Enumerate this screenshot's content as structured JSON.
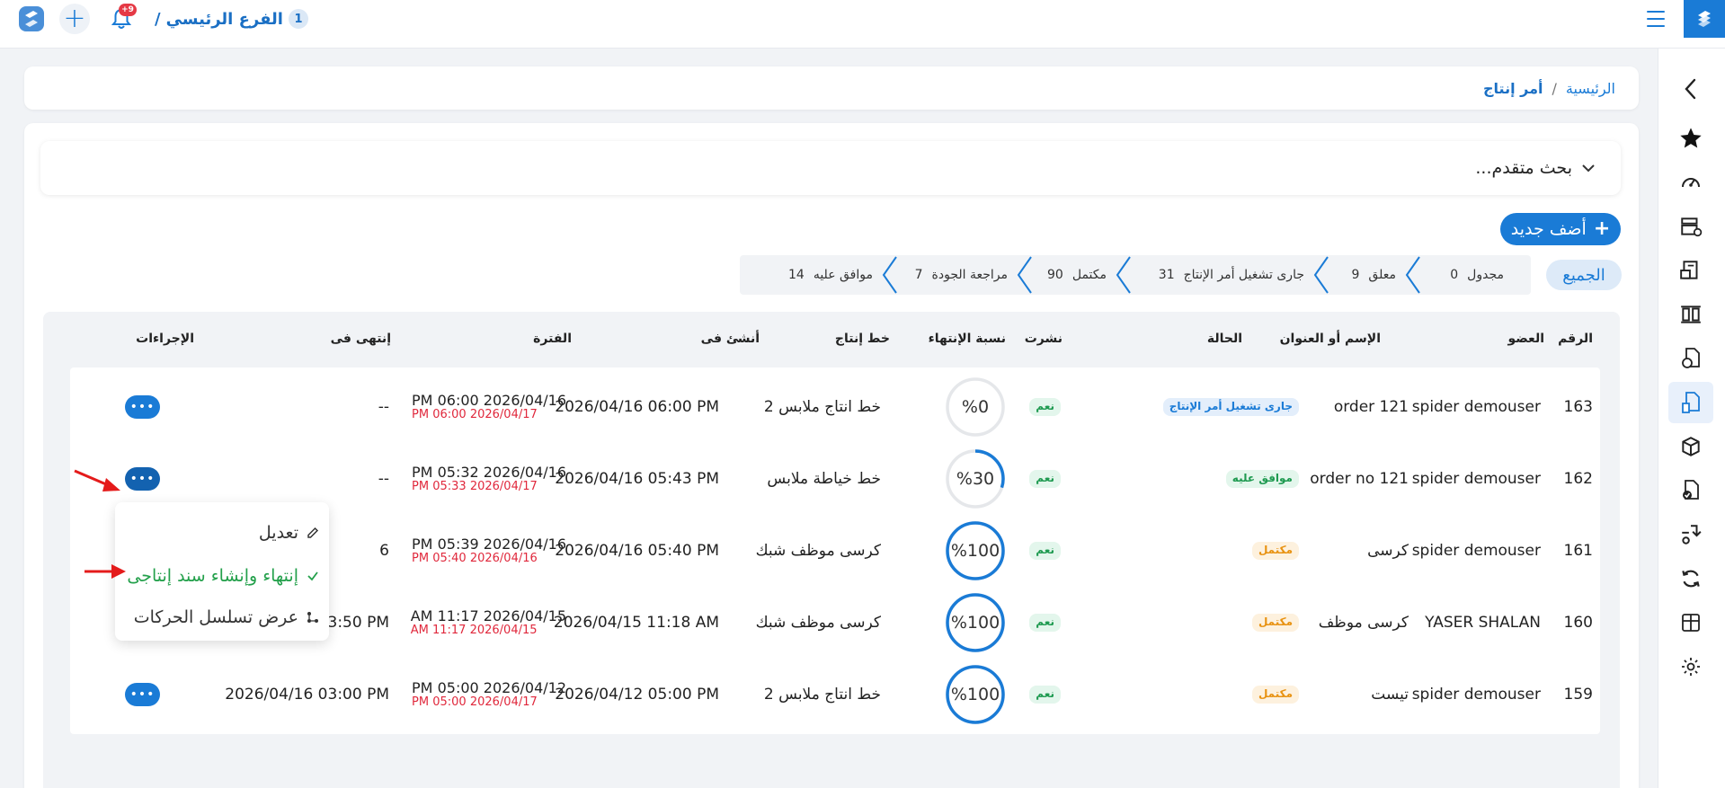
{
  "topbar": {
    "branch_number": "1",
    "branch_name": "الفرع الرئيسي",
    "branch_separator": "/",
    "notification_badge": "+9",
    "accent_color": "#1a7bd6"
  },
  "breadcrumb": {
    "home": "الرئيسية",
    "separator": "/",
    "current": "أمر إنتاج"
  },
  "search": {
    "advanced_label": "بحث متقدم..."
  },
  "toolbar": {
    "add_label": "أضف جديد",
    "add_icon": "+"
  },
  "statuses": {
    "all_label": "الجميع",
    "steps": [
      {
        "label": "مجدول",
        "count": "0"
      },
      {
        "label": "معلق",
        "count": "9"
      },
      {
        "label": "جارى تشغيل أمر الإنتاج",
        "count": "31"
      },
      {
        "label": "مكتمل",
        "count": "90"
      },
      {
        "label": "مراجعة الجودة",
        "count": "7"
      },
      {
        "label": "موافق عليه",
        "count": "14"
      }
    ]
  },
  "table": {
    "headers": {
      "number": "الرقم",
      "member": "العضو",
      "name": "الإسم أو العنوان",
      "status": "الحالة",
      "published": "نشرت",
      "completion": "نسبة الإنتهاء",
      "line": "خط إنتاج",
      "created": "أنشئ فى",
      "period": "الفترة",
      "ended": "إنتهى فى",
      "actions": "الإجراءات"
    },
    "rows": [
      {
        "number": "163",
        "member": "spider demouser",
        "name": "order 121",
        "status": "جارى تشغيل أمر الإنتاج",
        "status_color": "blue",
        "published": "نعم",
        "completion": "%0",
        "completion_value": 0,
        "line": "خط انتاج ملابس 2",
        "created": "2026/04/16 06:00 PM",
        "period_start": "2026/04/16 06:00 PM",
        "period_end": "2026/04/17 06:00 PM",
        "ended": "--",
        "actions_label": "•••"
      },
      {
        "number": "162",
        "member": "spider demouser",
        "name": "order no 121",
        "status": "موافق عليه",
        "status_color": "green",
        "published": "نعم",
        "completion": "%30",
        "completion_value": 30,
        "line": "خط خياطة ملابس",
        "created": "2026/04/16 05:43 PM",
        "period_start": "2026/04/16 05:32 PM",
        "period_end": "2026/04/17 05:33 PM",
        "ended": "--",
        "actions_label": "•••"
      },
      {
        "number": "161",
        "member": "spider demouser",
        "name": "كرسى",
        "status": "مكتمل",
        "status_color": "orange",
        "published": "نعم",
        "completion": "%100",
        "completion_value": 100,
        "line": "كرسى موظف شبك",
        "created": "2026/04/16 05:40 PM",
        "period_start": "2026/04/16 05:39 PM",
        "period_end": "2026/04/16 05:40 PM",
        "ended": "6",
        "actions_label": "•••"
      },
      {
        "number": "160",
        "member": "YASER SHALAN",
        "name": "كرسى موظف",
        "status": "مكتمل",
        "status_color": "orange",
        "published": "نعم",
        "completion": "%100",
        "completion_value": 100,
        "line": "كرسى موظف شبك",
        "created": "2026/04/15 11:18 AM",
        "period_start": "2026/04/15 11:17 AM",
        "period_end": "2026/04/15 11:17 AM",
        "ended": "2026/04/16 03:50 PM",
        "actions_label": "•••"
      },
      {
        "number": "159",
        "member": "spider demouser",
        "name": "تيست",
        "status": "مكتمل",
        "status_color": "orange",
        "published": "نعم",
        "completion": "%100",
        "completion_value": 100,
        "line": "خط انتاج ملابس 2",
        "created": "2026/04/12 05:00 PM",
        "period_start": "2026/04/12 05:00 PM",
        "period_end": "2026/04/17 05:00 PM",
        "ended": "2026/04/16 03:00 PM",
        "actions_label": "•••"
      }
    ]
  },
  "action_menu": {
    "edit": "تعديل",
    "finish": "إنتهاء وإنشاء سند إنتاجى",
    "trace": "عرض تسلسل الحركات"
  },
  "colors": {
    "primary": "#1a7bd6",
    "danger": "#e0283c",
    "success": "#23a04b",
    "warning": "#e89211"
  },
  "icons": [
    "brand-logo-icon",
    "menu-icon",
    "plus-icon",
    "bell-icon",
    "back-chevron-icon",
    "star-icon",
    "dashboard-icon",
    "edit-icon",
    "check-icon",
    "flow-icon"
  ]
}
